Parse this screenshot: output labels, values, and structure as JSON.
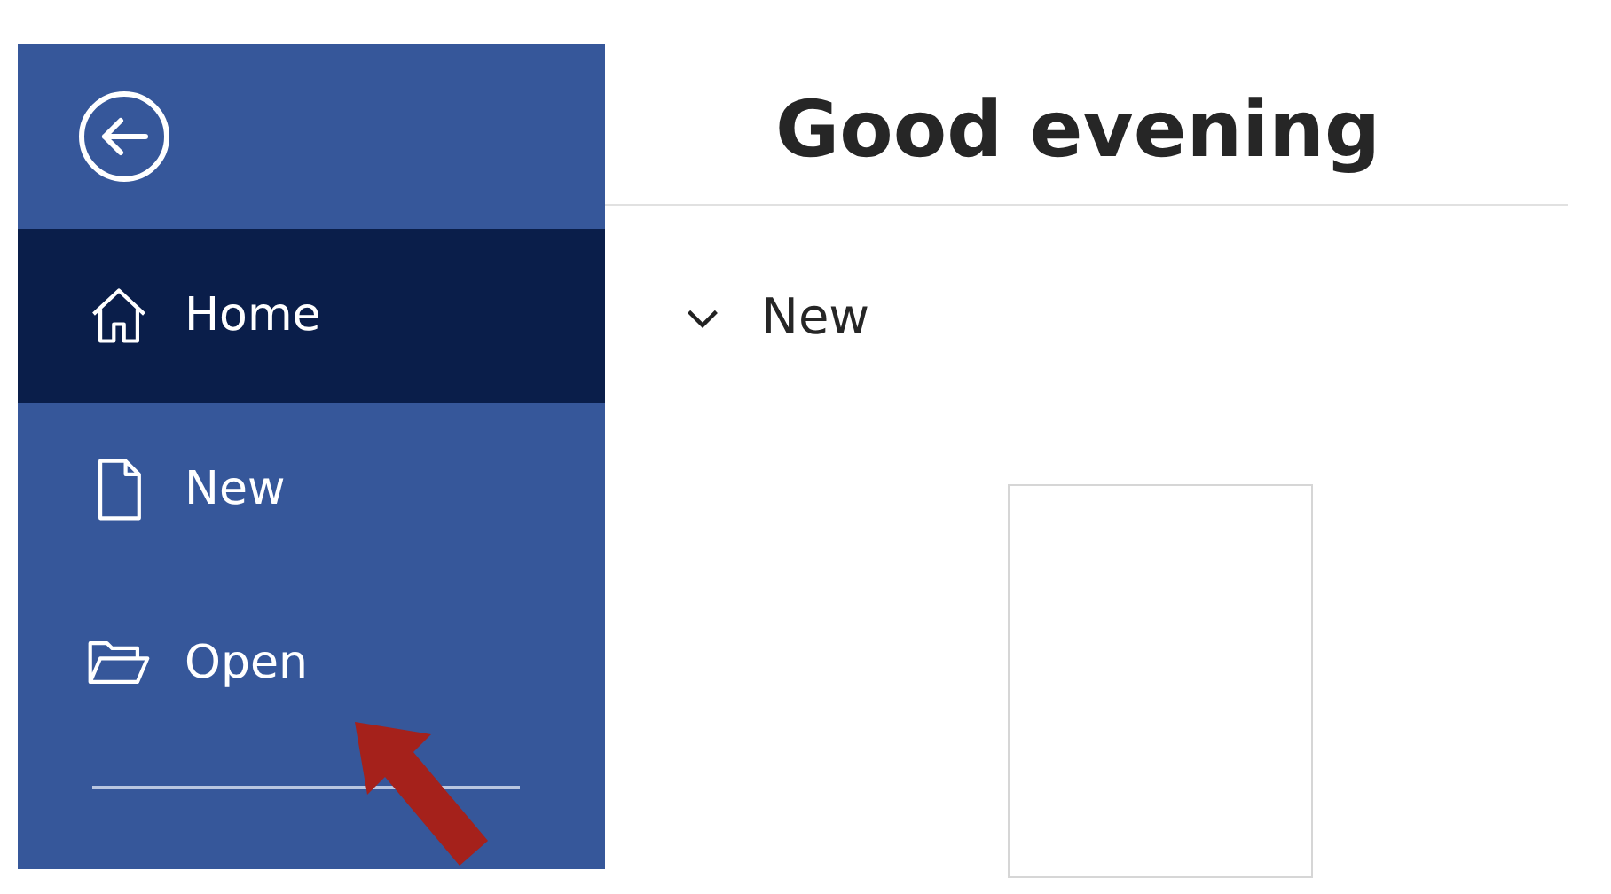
{
  "sidebar": {
    "items": [
      {
        "label": "Home",
        "kind": "home",
        "selected": true
      },
      {
        "label": "New",
        "kind": "new",
        "selected": false
      },
      {
        "label": "Open",
        "kind": "open",
        "selected": false
      }
    ]
  },
  "greeting": "Good evening",
  "section": {
    "title": "New",
    "expanded": true
  }
}
